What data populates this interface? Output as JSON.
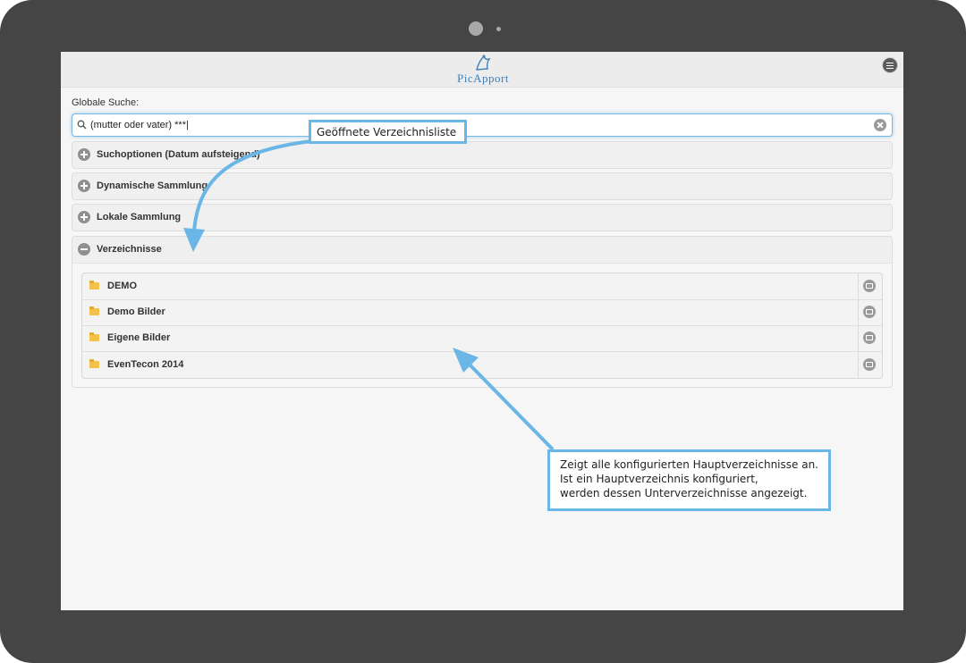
{
  "app": {
    "logo_text": "PicApport"
  },
  "search": {
    "label": "Globale Suche:",
    "value": "(mutter oder vater) ***|"
  },
  "sections": [
    {
      "label": "Suchoptionen (Datum aufsteigend)",
      "state": "collapsed"
    },
    {
      "label": "Dynamische Sammlung",
      "state": "collapsed"
    },
    {
      "label": "Lokale Sammlung",
      "state": "collapsed"
    },
    {
      "label": "Verzeichnisse",
      "state": "expanded"
    }
  ],
  "directories": [
    {
      "label": "DEMO"
    },
    {
      "label": "Demo Bilder"
    },
    {
      "label": "Eigene Bilder"
    },
    {
      "label": "EvenTecon 2014"
    }
  ],
  "annotations": {
    "callout_top": "Geöffnete Verzeichnisliste",
    "callout_bottom": [
      "Zeigt alle konfigurierten Hauptverzeichnisse an.",
      "Ist ein Hauptverzeichnis konfiguriert,",
      "werden dessen Unterverzeichnisse angezeigt."
    ]
  },
  "colors": {
    "accent": "#6ab6e6",
    "folder": "#f3c24a",
    "logo": "#3d7fb8"
  }
}
